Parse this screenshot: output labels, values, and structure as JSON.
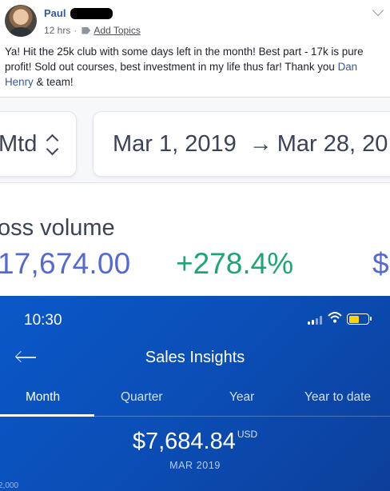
{
  "post": {
    "author": "Paul",
    "time": "12 hrs",
    "separator": "·",
    "add_topics": "Add Topics",
    "text_part1": "Ya! Hit the 25k club with some days left in the month! Best part - 17k is pure profit! Sold out courses, best investment in my life thus far! Thank you ",
    "mention": "Dan Henry",
    "text_part2": " & team!"
  },
  "stripe": {
    "range_preset": "Mtd",
    "start_date": "Mar 1, 2019",
    "arrow": "→",
    "end_date": "Mar 28, 20",
    "metric_label": "oss volume",
    "amount": "17,674.00",
    "change": "+278.4%",
    "next_value": "$"
  },
  "phone": {
    "status_time": "10:30",
    "title": "Sales Insights",
    "tabs": [
      "Month",
      "Quarter",
      "Year",
      "Year to date"
    ],
    "active_tab": "Month",
    "amount": "$7,684.84",
    "currency": "USD",
    "period": "MAR 2019",
    "axis_label": "2,000",
    "battery_level": 0.55,
    "battery_color": "#ffd200"
  },
  "colors": {
    "link": "#385898",
    "stripe_amount": "#5469d4",
    "stripe_change": "#1ea672",
    "paypal_bg": "#0b4fb8"
  }
}
